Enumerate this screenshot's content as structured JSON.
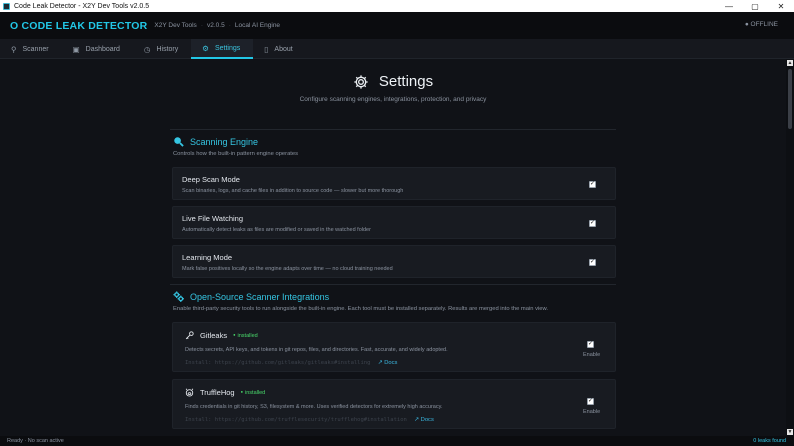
{
  "window": {
    "title": "Code Leak Detector - X2Y Dev Tools  v2.0.5",
    "minimize": "—",
    "maximize": "▢",
    "close": "✕"
  },
  "header": {
    "brand": "O CODE LEAK DETECTOR",
    "vendor": "X2Y Dev Tools",
    "version": "v2.0.5",
    "engine": "Local AI Engine",
    "separator": "·",
    "status": "● OFFLINE"
  },
  "tabs": [
    {
      "label": "Scanner",
      "icon": "search-icon",
      "glyph": "⚲"
    },
    {
      "label": "Dashboard",
      "icon": "dashboard-icon",
      "glyph": "▣"
    },
    {
      "label": "History",
      "icon": "clock-icon",
      "glyph": "◷"
    },
    {
      "label": "Settings",
      "icon": "gear-icon",
      "glyph": "⚙",
      "active": true
    },
    {
      "label": "About",
      "icon": "info-icon",
      "glyph": "▯"
    }
  ],
  "page": {
    "title": "Settings",
    "subtitle": "Configure scanning engines, integrations, protection, and privacy"
  },
  "scanning_engine": {
    "title": "Scanning Engine",
    "description": "Controls how the built-in pattern engine operates",
    "options": [
      {
        "title": "Deep Scan Mode",
        "description": "Scan binaries, logs, and cache files in addition to source code — slower but more thorough",
        "checked": true
      },
      {
        "title": "Live File Watching",
        "description": "Automatically detect leaks as files are modified or saved in the watched folder",
        "checked": true
      },
      {
        "title": "Learning Mode",
        "description": "Mark false positives locally so the engine adapts over time — no cloud training needed",
        "checked": true
      }
    ]
  },
  "integrations": {
    "title": "Open-Source Scanner Integrations",
    "description": "Enable third-party security tools to run alongside the built-in engine. Each tool must be installed separately. Results are merged into the main view.",
    "tools": [
      {
        "name": "Gitleaks",
        "status": "installed",
        "description": "Detects secrets, API keys, and tokens in git repos, files, and directories. Fast, accurate, and widely adopted.",
        "install": "Install:   https://github.com/gitleaks/gitleaks#installing",
        "docs": "↗ Docs",
        "enable_label": "Enable",
        "checked": true,
        "icon": "key-icon"
      },
      {
        "name": "TruffleHog",
        "status": "installed",
        "description": "Finds credentials in git history, S3, filesystem & more. Uses verified detectors for extremely high accuracy.",
        "install": "Install:   https://github.com/trufflesecurity/trufflehog#installation",
        "docs": "↗ Docs",
        "enable_label": "Enable",
        "checked": true,
        "icon": "pig-icon"
      }
    ]
  },
  "statusbar": {
    "left": "Ready  ·  No scan active",
    "right": "0 leaks found"
  },
  "colors": {
    "accent": "#22c7e6",
    "installed": "#49d96b",
    "background": "#101217"
  }
}
